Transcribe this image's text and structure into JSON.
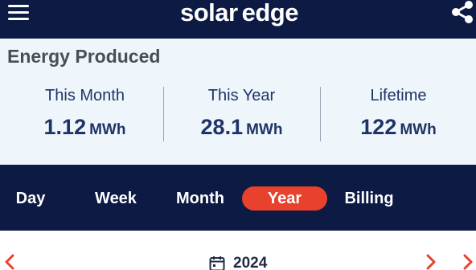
{
  "header": {
    "logo_part1": "solar",
    "logo_part2": "edge",
    "menu_icon": "hamburger-menu-icon",
    "share_icon": "share-icon"
  },
  "energy": {
    "title": "Energy Produced",
    "stats": [
      {
        "label": "This Month",
        "value": "1.12",
        "unit": "MWh"
      },
      {
        "label": "This Year",
        "value": "28.1",
        "unit": "MWh"
      },
      {
        "label": "Lifetime",
        "value": "122",
        "unit": "MWh"
      }
    ]
  },
  "tabs": [
    {
      "label": "Day",
      "active": false
    },
    {
      "label": "Week",
      "active": false
    },
    {
      "label": "Month",
      "active": false
    },
    {
      "label": "Year",
      "active": true
    },
    {
      "label": "Billing",
      "active": false
    }
  ],
  "date_nav": {
    "current": "2024",
    "calendar_icon": "calendar-icon",
    "prev_icon": "chevron-left-icon",
    "next_icon": "chevron-right-icon",
    "last_icon": "double-chevron-right-icon"
  },
  "colors": {
    "navy": "#0c1a44",
    "accent": "#e8412c",
    "panel": "#eef5fb",
    "text": "#1f3466"
  }
}
